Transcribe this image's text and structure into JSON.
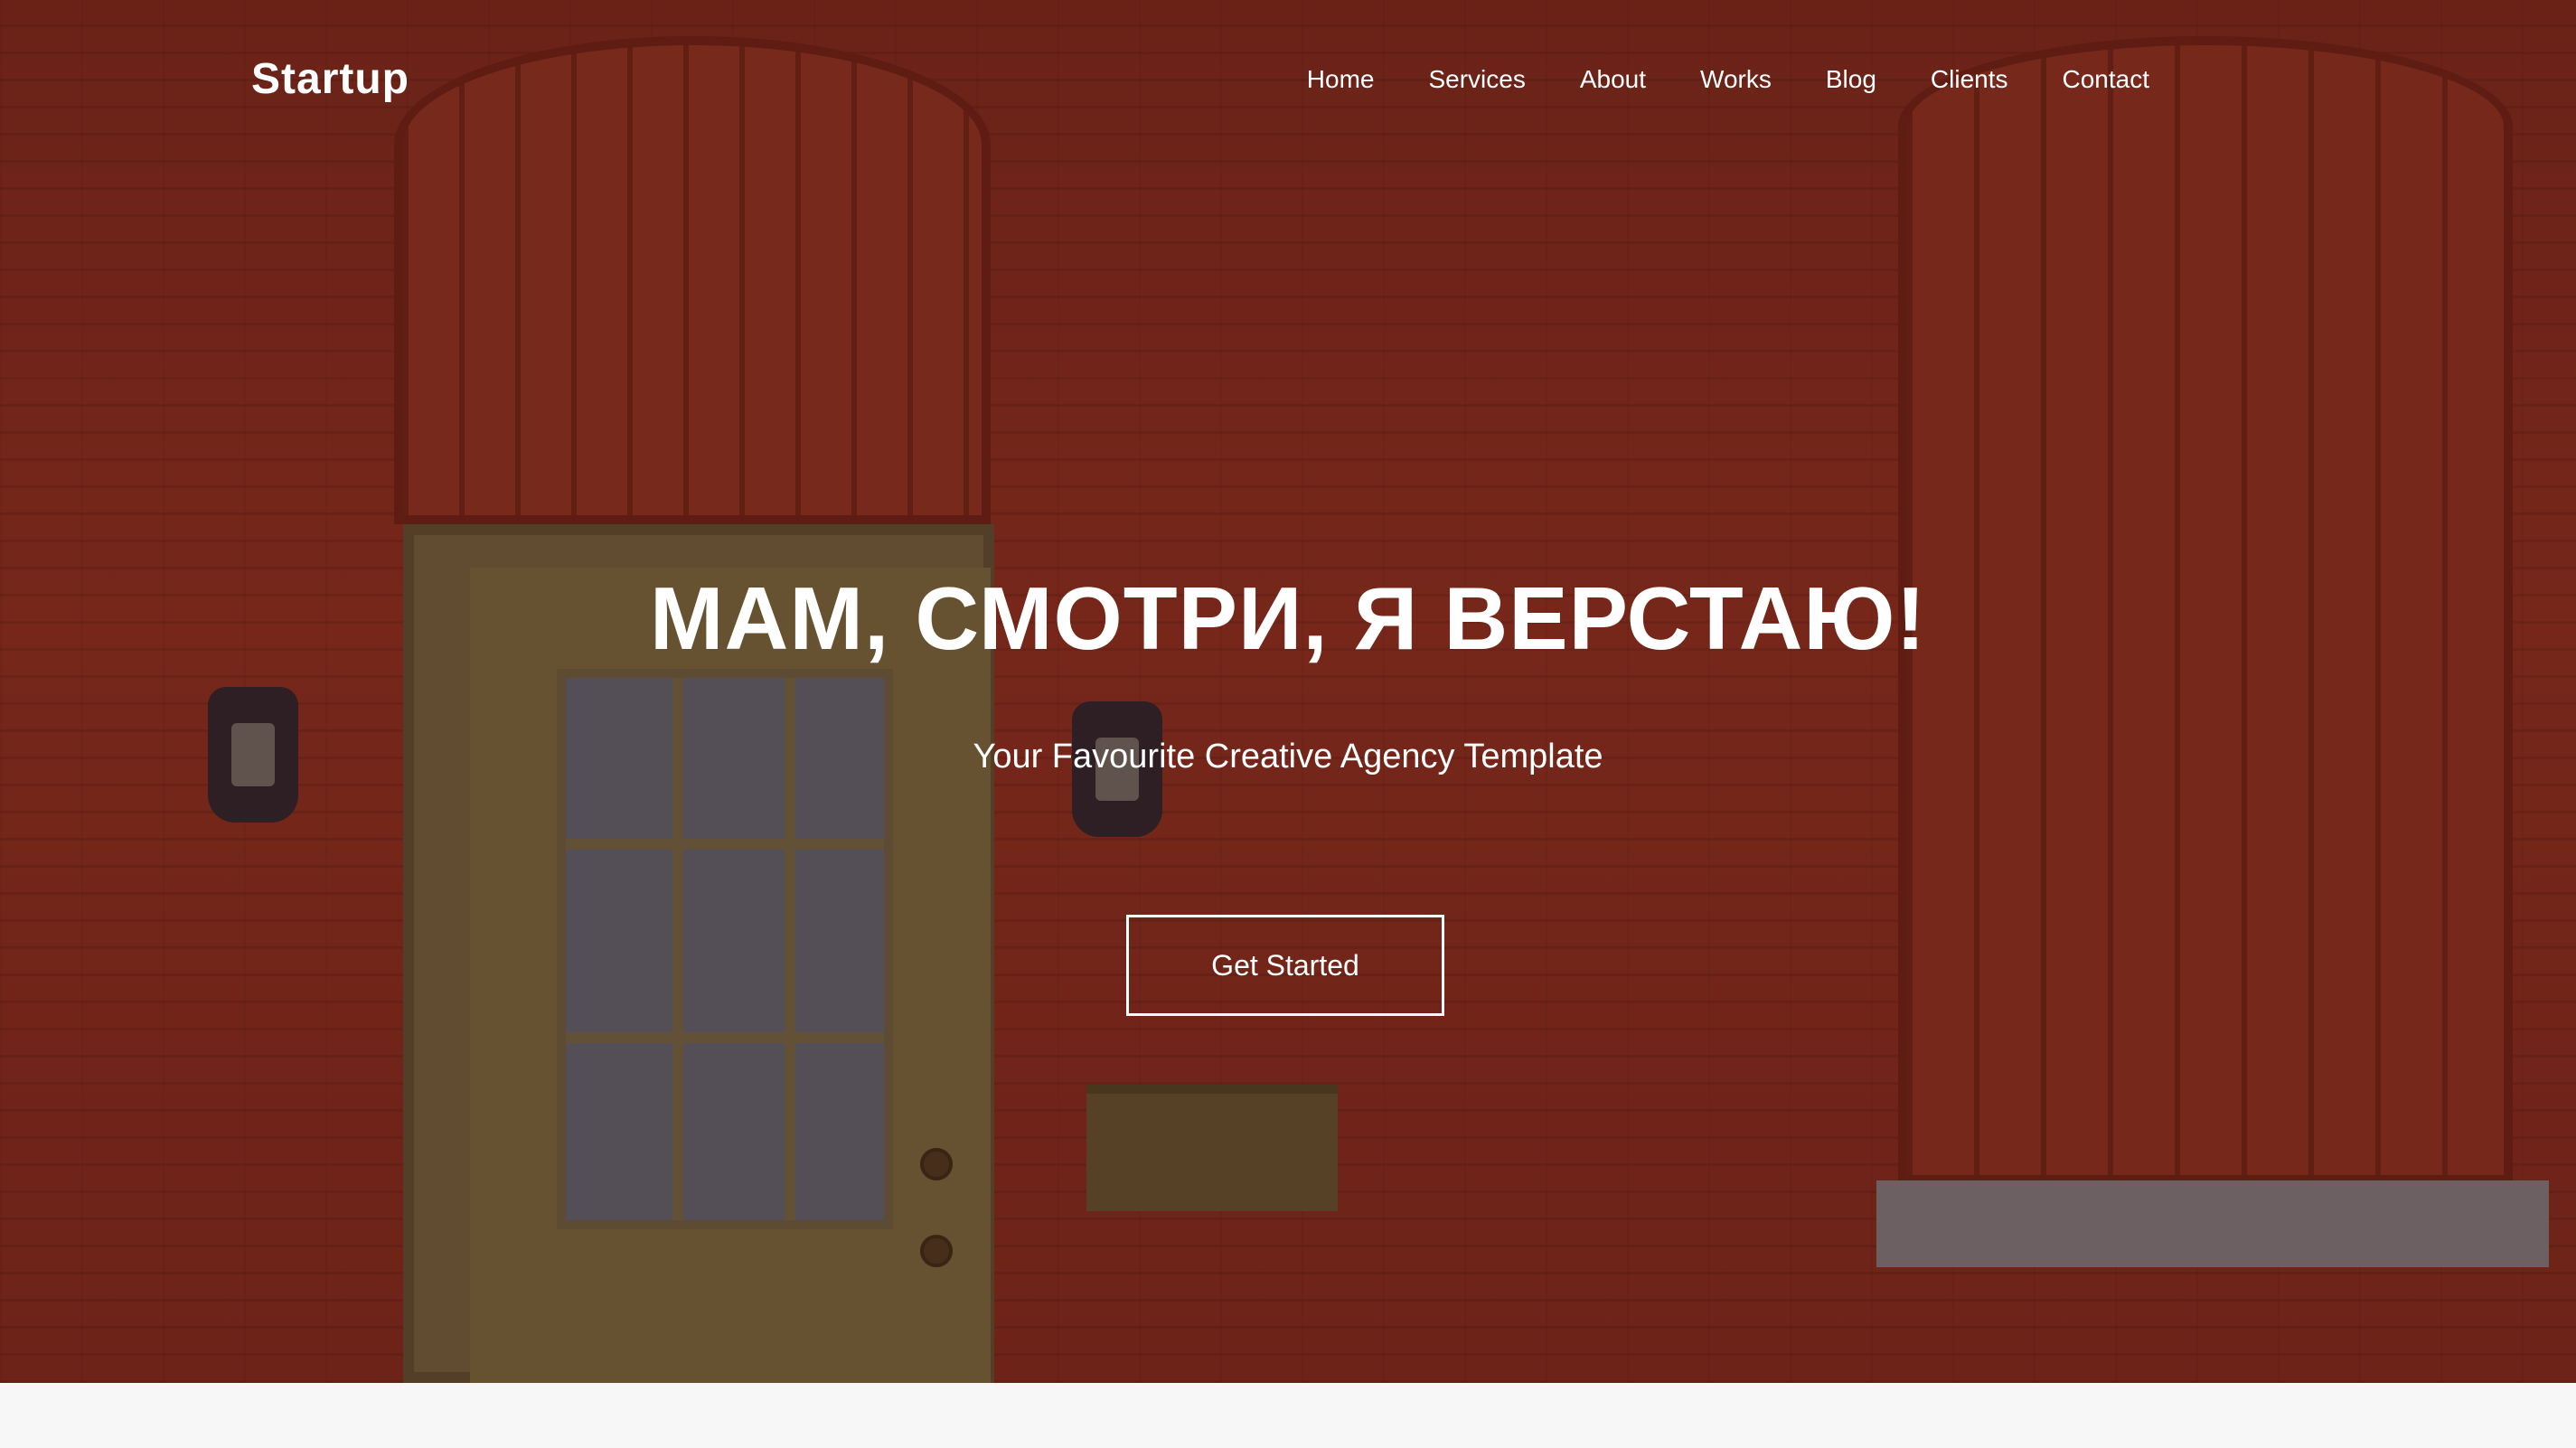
{
  "header": {
    "logo": "Startup",
    "nav": [
      {
        "label": "Home"
      },
      {
        "label": "Services"
      },
      {
        "label": "About"
      },
      {
        "label": "Works"
      },
      {
        "label": "Blog"
      },
      {
        "label": "Clients"
      },
      {
        "label": "Contact"
      }
    ]
  },
  "hero": {
    "title": "МАМ, СМОТРИ, Я ВЕРСТАЮ!",
    "subtitle": "Your Favourite Creative Agency Template",
    "cta_label": "Get Started",
    "background_image": "red-brick-wall-with-door"
  },
  "colors": {
    "text": "#ffffff",
    "brick": "#8a3022",
    "below_fold": "#f7f7f7"
  }
}
